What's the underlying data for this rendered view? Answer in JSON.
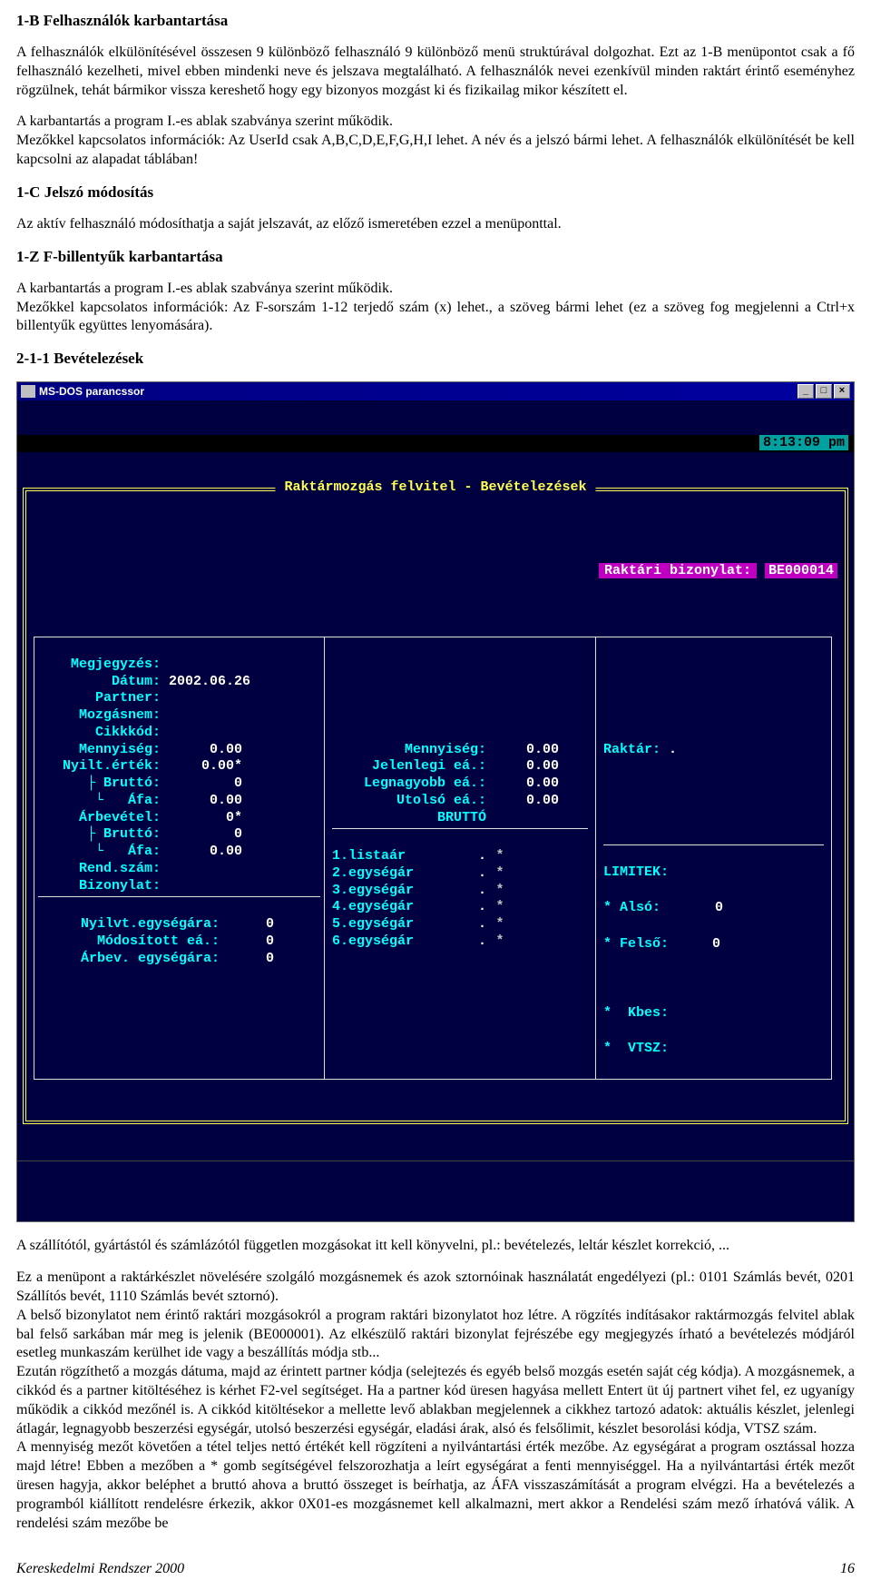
{
  "section1": {
    "title": "1-B Felhasználók karbantartása",
    "p1": "A felhasználók elkülönítésével összesen 9 különböző felhasználó 9 különböző menü struktúrával dolgozhat. Ezt az 1-B menüpontot csak a fő felhasználó kezelheti, mivel ebben mindenki neve és jelszava megtalálható. A felhasználók nevei ezenkívül minden raktárt érintő eseményhez rögzülnek, tehát bármikor vissza kereshető hogy egy bizonyos mozgást ki és fizikailag mikor készített el.",
    "p2": "A karbantartás a program I.-es ablak szabványa szerint működik.",
    "p3": "Mezőkkel kapcsolatos információk: Az UserId csak A,B,C,D,E,F,G,H,I lehet. A név és a jelszó bármi lehet. A felhasználók elkülönítését be kell kapcsolni az alapadat táblában!"
  },
  "section2": {
    "title": "1-C Jelszó módosítás",
    "p1": "Az aktív felhasználó módosíthatja a saját jelszavát, az előző ismeretében ezzel a menüponttal."
  },
  "section3": {
    "title": "1-Z F-billentyűk karbantartása",
    "p1": "A karbantartás a program I.-es ablak szabványa szerint működik.",
    "p2": "Mezőkkel kapcsolatos információk: Az F-sorszám 1-12 terjedő szám (x) lehet., a szöveg bármi lehet (ez a szöveg fog megjelenni a Ctrl+x billentyűk együttes lenyomására)."
  },
  "section4": {
    "title": "2-1-1 Bevételezések"
  },
  "dos": {
    "titlebar": "MS-DOS parancssor",
    "time": "8:13:09 pm",
    "frameTitle": "Raktármozgás felvitel - Bevételezések",
    "bizonylatLabel": "Raktári bizonylat:",
    "bizonylatVal": "BE000014",
    "left": {
      "megjegyzes": "Megjegyzés:",
      "datum": "Dátum:",
      "datumVal": "2002.06.26",
      "partner": "Partner:",
      "mozgasnem": "Mozgásnem:",
      "cikkkod": "Cikkkód:",
      "mennyiseg": "Mennyiség:",
      "mennyisegVal": "0.00",
      "nyilt": "Nyilt.érték:",
      "nyiltVal": "0.00*",
      "brutto": "├ Bruttó:",
      "bruttoVal": "0",
      "afa": "└   Áfa:",
      "afaVal": "0.00",
      "arbevetel": "Árbevétel:",
      "arbevVal": "0*",
      "brutto2": "├ Bruttó:",
      "brutto2Val": "0",
      "afa2": "└   Áfa:",
      "afa2Val": "0.00",
      "rendszam": "Rend.szám:",
      "bizonylat": "Bizonylat:",
      "nyilv": "Nyilvt.egységára:",
      "nyilvVal": "0",
      "modositott": "Módosított eá.:",
      "modVal": "0",
      "arbev": "Árbev. egységára:",
      "arbevEVal": "0"
    },
    "mid": {
      "mennyiseg": "Mennyiség:",
      "mennyisegVal": "0.00",
      "jelenlegi": "Jelenlegi eá.:",
      "jelenlegiVal": "0.00",
      "legnagyobb": "Legnagyobb eá.:",
      "legnagyobbVal": "0.00",
      "utolso": "Utolsó eá.:",
      "utolsoVal": "0.00",
      "brutto": "BRUTTÓ",
      "listaar": "1.listaár",
      "listaarV": ".",
      "listaarS": "*",
      "e2": "2.egységár",
      "e2V": ".",
      "e2S": "*",
      "e3": "3.egységár",
      "e3V": ".",
      "e3S": "*",
      "e4": "4.egységár",
      "e4V": ".",
      "e4S": "*",
      "e5": "5.egységár",
      "e5V": ".",
      "e5S": "*",
      "e6": "6.egységár",
      "e6V": ".",
      "e6S": "*"
    },
    "right": {
      "raktar": "Raktár:",
      "raktarVal": ".",
      "limitek": "LIMITEK:",
      "also": "* Alsó:",
      "alsoVal": "0",
      "felso": "* Felső:",
      "felsoVal": "0",
      "kbes": "*  Kbes:",
      "vtsz": "*  VTSZ:"
    }
  },
  "after": {
    "p1": "A szállítótól, gyártástól és számlázótól független mozgásokat itt kell könyvelni, pl.: bevételezés, leltár készlet korrekció, ...",
    "p2": "Ez a menüpont a raktárkészlet növelésére szolgáló mozgásnemek és azok sztornóinak használatát engedélyezi (pl.: 0101 Számlás bevét, 0201 Szállítós bevét, 1110 Számlás bevét sztornó).",
    "p3": "A belső bizonylatot nem érintő raktári mozgásokról a program raktári bizonylatot hoz létre. A rögzítés indításakor raktármozgás felvitel ablak bal felső sarkában már meg is jelenik (BE000001). Az elkészülő raktári bizonylat fejrészébe egy megjegyzés írható a bevételezés módjáról esetleg munkaszám kerülhet ide vagy a beszállítás módja stb...",
    "p4": "Ezután rögzíthető a mozgás dátuma, majd az érintett partner kódja (selejtezés és egyéb belső mozgás esetén saját cég kódja). A mozgásnemek, a cikkód és a partner kitöltéséhez is kérhet F2-vel segítséget. Ha a partner kód üresen hagyása mellett Entert üt új partnert vihet fel, ez ugyanígy működik a cikkód mezőnél is. A cikkód kitöltésekor a mellette levő ablakban megjelennek a cikkhez tartozó adatok: aktuális készlet, jelenlegi átlagár, legnagyobb beszerzési egységár, utolsó beszerzési egységár, eladási árak, alsó és felsőlimit, készlet besorolási kódja, VTSZ szám.",
    "p5": "A mennyiség mezőt követően a tétel teljes nettó értékét kell rögzíteni a nyilvántartási érték mezőbe. Az egységárat a program osztással hozza majd létre! Ebben a mezőben a * gomb segítségével felszorozhatja a leírt egységárat a fenti mennyiséggel. Ha a nyilvántartási érték mezőt üresen hagyja, akkor beléphet a bruttó ahova a bruttó összeget is beírhatja, az ÁFA visszaszámítását a program elvégzi. Ha a bevételezés a programból kiállított rendelésre érkezik, akkor 0X01-es mozgásnemet kell alkalmazni, mert akkor a Rendelési szám mező írhatóvá válik. A rendelési szám mezőbe be"
  },
  "footer": {
    "left": "Kereskedelmi Rendszer 2000",
    "right": "16"
  }
}
